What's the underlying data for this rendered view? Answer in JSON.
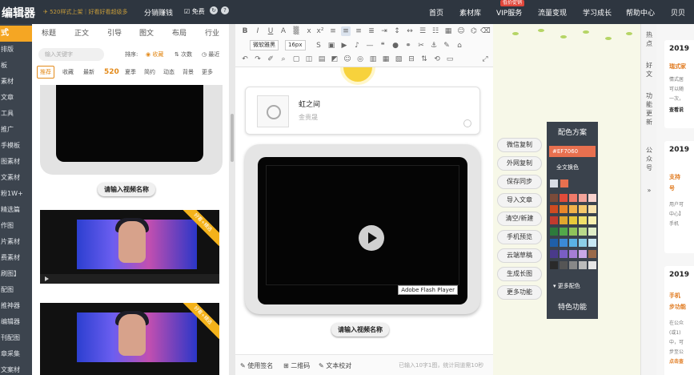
{
  "topbar": {
    "logo": "编辑器",
    "promo": "✈ 520样式上架｜好看好看超级多",
    "distribution": "分销赚钱",
    "free_label": "☑ 免费",
    "nav": [
      "首页",
      "素材库",
      "VIP服务",
      "流量变现",
      "学习成长",
      "帮助中心",
      "贝贝"
    ],
    "badge": "低价促销"
  },
  "iconbar": {
    "items": [
      "式",
      "排版",
      "板",
      "素材",
      "文章",
      "工具",
      "推广",
      "手模板",
      "图素材",
      "文素材",
      "粉1W+",
      "精选篇",
      "作图",
      "片素材",
      "费素材",
      "刷图】",
      "配图",
      "推神器",
      "编辑器",
      "刊配图",
      "章采集",
      "文案材"
    ]
  },
  "materials": {
    "categories": [
      "标题",
      "正文",
      "引导",
      "图文",
      "布局",
      "行业"
    ],
    "search_placeholder": "输入关键字",
    "sort_label": "排序:",
    "sort_options": [
      "◉ 收藏",
      "⇅ 次数",
      "◷ 最近"
    ],
    "filters": [
      "推荐",
      "收藏",
      "最新",
      "520",
      "夏季",
      "简约",
      "动态",
      "背景",
      "更多"
    ],
    "video_name_btn": "请输入视频名称",
    "ribbon": "好看+精选"
  },
  "editor": {
    "font_family": "微软雅黑",
    "font_size": "16px",
    "audio": {
      "title": "虹之间",
      "artist": "金贵晟"
    },
    "video_name_btn": "请输入视频名称",
    "flash_label": "Adobe Flash Player",
    "status": {
      "sign": "✎ 使用签名",
      "qr": "⊞ 二维码",
      "proof": "✎ 文本校对",
      "count": "已输入10字1图，统计同道需10秒"
    }
  },
  "tools": {
    "buttons": [
      "微信复制",
      "外网复制",
      "保存同步",
      "导入文章",
      "清空/新建",
      "手机预览",
      "云端草稿",
      "生成长图",
      "更多功能"
    ]
  },
  "palette": {
    "title": "配色方案",
    "hex": "#EF7060",
    "full_label": "全文换色",
    "more": "▾ 更多配色",
    "feature": "特色功能",
    "swatch_colors": [
      "#d8dde5",
      "#e8704f",
      "#7b4b3a",
      "#e04b3a",
      "#f07a6a",
      "#f3a49a",
      "#f8d3cd",
      "#d04b20",
      "#e9862a",
      "#f2b24a",
      "#f5c86b",
      "#f8e2ad",
      "#c13b2e",
      "#e0a72e",
      "#e8c93a",
      "#f0e06a",
      "#f8f0b0",
      "#2d7a3c",
      "#52a84a",
      "#8fc35a",
      "#b9d98a",
      "#e0eec8",
      "#1f5fa8",
      "#3b8ad6",
      "#5ab2e4",
      "#8ccfe8",
      "#c8e8f4",
      "#4a3a8a",
      "#7a5ec4",
      "#a57ed6",
      "#c8a8e6",
      "#9a6a4a",
      "#2a2a2a",
      "#555555",
      "#888888",
      "#bbbbbb",
      "#e6e6e6"
    ]
  },
  "hottabs": [
    "热点",
    "好文",
    "功能更新",
    "公众号",
    "»"
  ],
  "newsfeed": {
    "cards": [
      {
        "year": "2019",
        "lines": [
          "瑞式家",
          "情式居",
          "可以随",
          "一次，",
          "查看说"
        ]
      },
      {
        "year": "2019",
        "lines": [
          "支持",
          "号",
          "用户可",
          "中心】",
          "手机"
        ]
      },
      {
        "year": "2019",
        "lines": [
          "手机",
          "步功能",
          "在公众",
          "(或1)",
          "中，可",
          "步至公",
          "点击查"
        ]
      }
    ]
  }
}
